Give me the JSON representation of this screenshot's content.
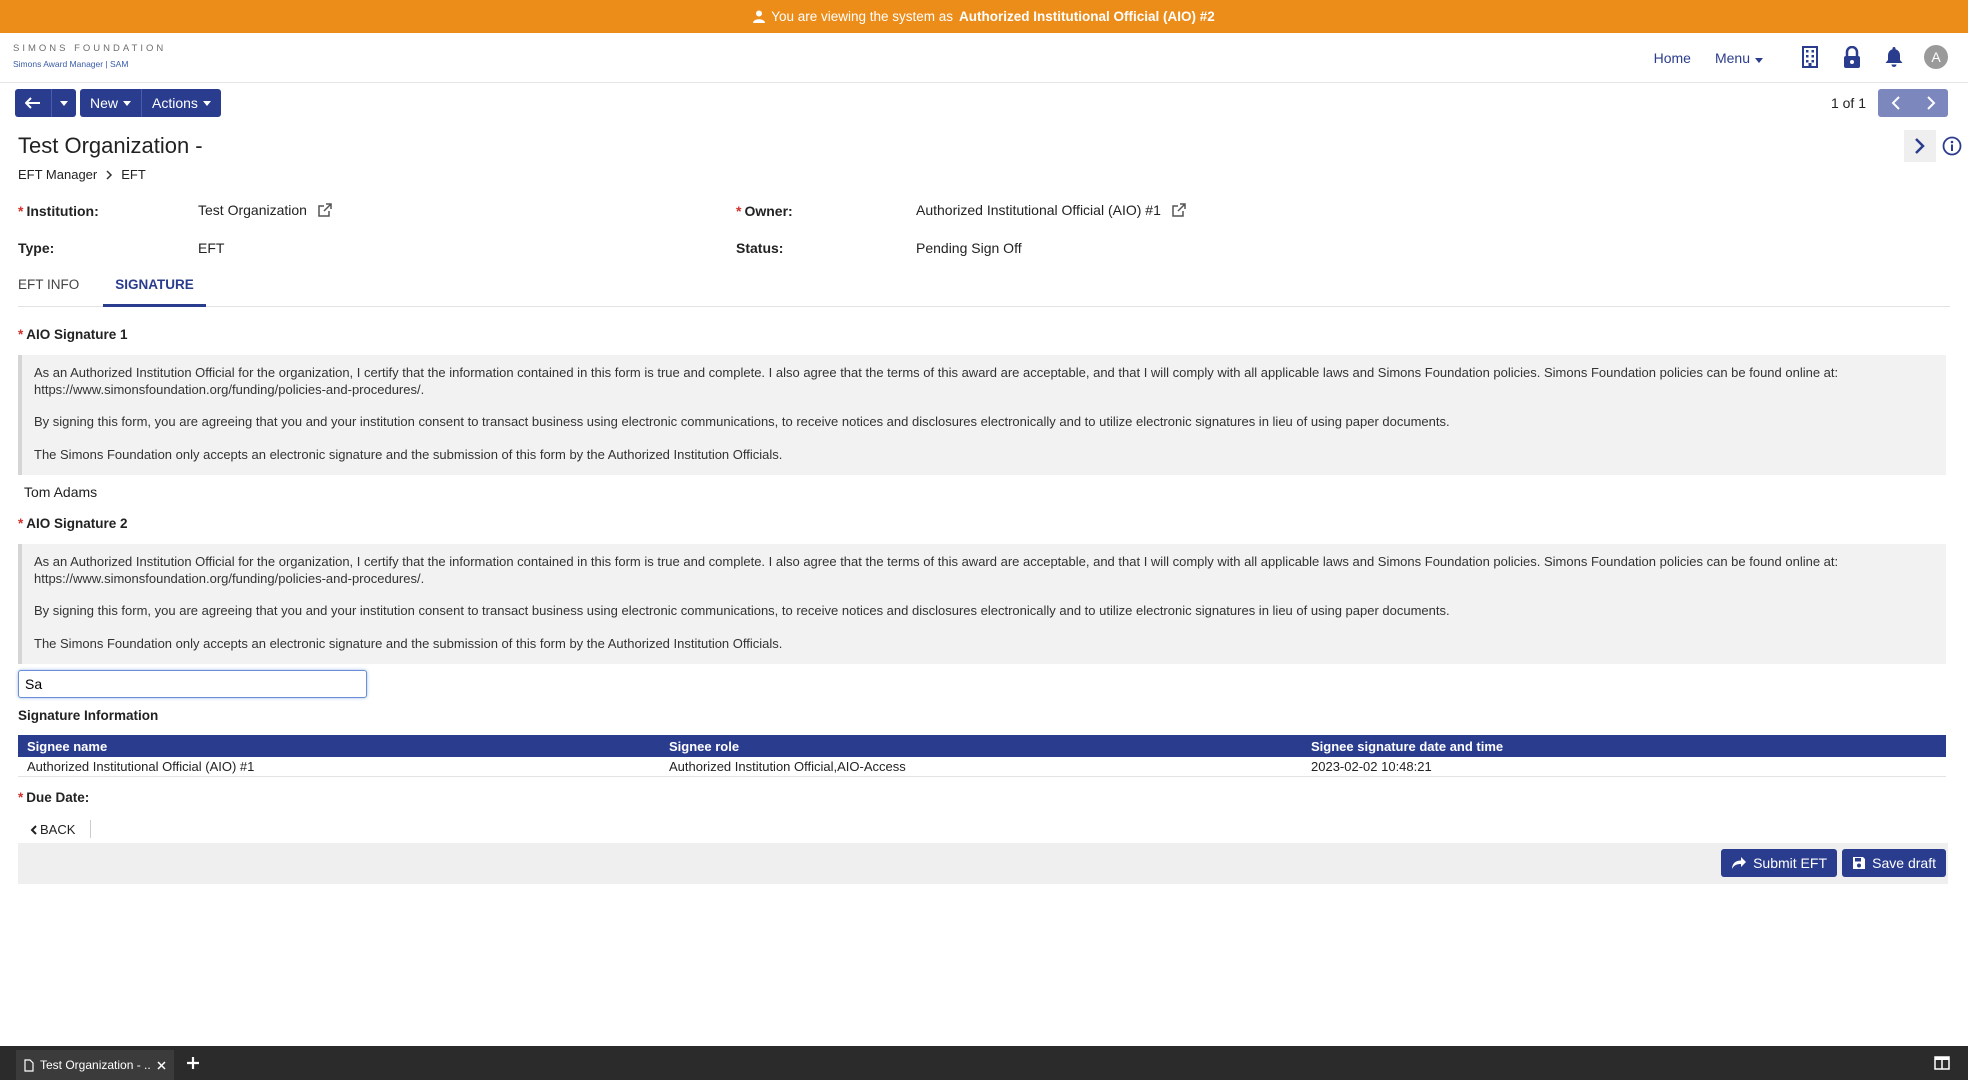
{
  "banner": {
    "prefix": "You are viewing the system as",
    "role": "Authorized Institutional Official (AIO) #2"
  },
  "header": {
    "logo_main": "SIMONS FOUNDATION",
    "logo_sub": "Simons Award Manager  |  SAM",
    "nav": [
      "Home",
      "Menu"
    ],
    "avatar_letter": "A"
  },
  "toolbar": {
    "new_label": "New",
    "actions_label": "Actions"
  },
  "pager": {
    "text": "1 of 1"
  },
  "page": {
    "title": "Test Organization -",
    "breadcrumb": [
      "EFT Manager",
      "EFT"
    ]
  },
  "fields": {
    "institution_label": "Institution:",
    "institution_value": "Test Organization",
    "owner_label": "Owner:",
    "owner_value": "Authorized Institutional Official (AIO) #1",
    "type_label": "Type:",
    "type_value": "EFT",
    "status_label": "Status:",
    "status_value": "Pending Sign Off"
  },
  "tabs": [
    "EFT INFO",
    "SIGNATURE"
  ],
  "signature1": {
    "label": "AIO Signature 1",
    "para1": "As an Authorized Institution Official for the organization, I certify that the information contained in this form is true and complete. I also agree that the terms of this award are acceptable, and that I will comply with all applicable laws and Simons Foundation policies. Simons Foundation policies can be found online at: https://www.simonsfoundation.org/funding/policies-and-procedures/.",
    "para2": "By signing this form, you are agreeing that you and your institution consent to transact business using electronic communications, to receive notices and disclosures electronically and to utilize electronic signatures in lieu of using paper documents.",
    "para3": "The Simons Foundation only accepts an electronic signature and the submission of this form by the Authorized Institution Officials.",
    "signed_name": "Tom Adams"
  },
  "signature2": {
    "label": "AIO Signature 2",
    "para1": "As an Authorized Institution Official for the organization, I certify that the information contained in this form is true and complete. I also agree that the terms of this award are acceptable, and that I will comply with all applicable laws and Simons Foundation policies. Simons Foundation policies can be found online at: https://www.simonsfoundation.org/funding/policies-and-procedures/.",
    "para2": "By signing this form, you are agreeing that you and your institution consent to transact business using electronic communications, to receive notices and disclosures electronically and to utilize electronic signatures in lieu of using paper documents.",
    "para3": "The Simons Foundation only accepts an electronic signature and the submission of this form by the Authorized Institution Officials.",
    "input_value": "Sa"
  },
  "signature_info": {
    "heading": "Signature Information",
    "columns": [
      "Signee name",
      "Signee role",
      "Signee signature date and time"
    ],
    "rows": [
      [
        "Authorized Institutional Official (AIO) #1",
        "Authorized Institution Official,AIO-Access",
        "2023-02-02 10:48:21"
      ]
    ]
  },
  "due_date_label": "Due Date:",
  "back_label": "BACK",
  "actions": {
    "submit_label": "Submit EFT",
    "save_label": "Save draft"
  },
  "taskbar": {
    "tab_title": "Test Organization - ..."
  },
  "colors": {
    "banner": "#ec8c19",
    "primary": "#2a3c8e",
    "required": "#d0312d"
  }
}
